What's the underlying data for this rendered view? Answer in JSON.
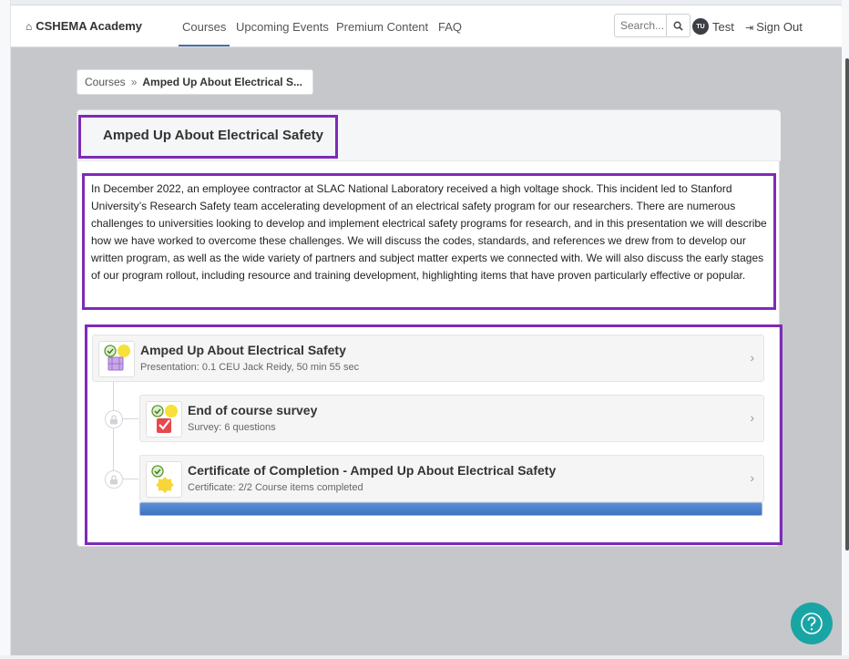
{
  "nav": {
    "brand": "CSHEMA Academy",
    "links": [
      "Courses",
      "Upcoming Events",
      "Premium Content",
      "FAQ"
    ],
    "active": "Courses",
    "search_placeholder": "Search...",
    "user_initials": "TU",
    "user_name": "Test",
    "signout_label": "Sign Out"
  },
  "breadcrumb": {
    "root": "Courses",
    "separator": "»",
    "current": "Amped Up About Electrical S..."
  },
  "course": {
    "title": "Amped Up About Electrical Safety",
    "description": "In December 2022, an employee contractor at SLAC National Laboratory received a high voltage shock. This incident led to Stanford University’s Research Safety team accelerating development of an electrical safety program for our researchers. There are numerous challenges to universities looking to develop and implement electrical safety programs for research, and in this presentation we will describe how we have worked to overcome these challenges. We will discuss the codes, standards, and references we drew from to develop our written program, as well as the wide variety of partners and subject matter experts we connected with. We will also discuss the early stages of our program rollout, including resource and training development, highlighting items that have proven particularly effective or popular."
  },
  "items": [
    {
      "title": "Amped Up About Electrical Safety",
      "subtitle": "Presentation:  0.1 CEU  Jack Reidy,  50 min 55 sec",
      "icon": "presentation-icon"
    },
    {
      "title": "End of course survey",
      "subtitle": "Survey: 6 questions",
      "icon": "survey-icon"
    },
    {
      "title": "Certificate of Completion - Amped Up About Electrical Safety",
      "subtitle": "Certificate:  2/2 Course items completed",
      "icon": "certificate-icon"
    }
  ],
  "progress": {
    "completed": 2,
    "total": 2,
    "fraction": 1.0
  },
  "colors": {
    "highlight": "#7d2bb8",
    "accent": "#4a6fa5",
    "progress": "#3f73bf",
    "help": "#1aa5a5"
  }
}
